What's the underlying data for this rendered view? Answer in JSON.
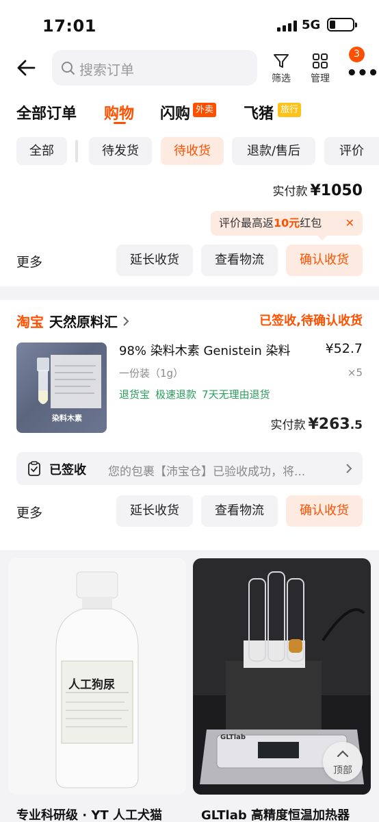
{
  "status_bar": {
    "time": "17:01",
    "network": "5G"
  },
  "header": {
    "search_placeholder": "搜索订单",
    "filter_label": "筛选",
    "manage_label": "管理",
    "more_badge": "3"
  },
  "category_tabs": [
    {
      "label": "全部订单",
      "active": false
    },
    {
      "label": "购物",
      "active": true
    },
    {
      "label": "闪购",
      "tag": "外卖",
      "tag_color": "#ff5000"
    },
    {
      "label": "飞猪",
      "tag": "旅行",
      "tag_color": "#ffc21a"
    }
  ],
  "filter_chips": [
    {
      "label": "全部",
      "active": false
    },
    {
      "label": "待发货",
      "active": false
    },
    {
      "label": "待收货",
      "active": true
    },
    {
      "label": "退款/售后",
      "active": false
    },
    {
      "label": "评价",
      "active": false
    }
  ],
  "order1": {
    "pay_label": "实付款",
    "pay_amount": "¥1050",
    "promo_prefix": "评价最高返",
    "promo_highlight": "10元",
    "promo_suffix": "红包",
    "more_label": "更多",
    "actions": [
      "延长收货",
      "查看物流",
      "确认收货"
    ]
  },
  "order2": {
    "platform": "淘宝",
    "shop_name": "天然原料汇",
    "status": "已签收,待确认收货",
    "product_name": "98% 染料木素 Genistein 染料",
    "product_price": "¥52.7",
    "product_spec": "一份装（1g）",
    "product_qty": "×5",
    "services": [
      "退货宝",
      "极速退款",
      "7天无理由退货"
    ],
    "pay_label": "实付款",
    "pay_amount": "¥263",
    "pay_decimal": ".5",
    "image_text": "染料木素",
    "logistics_status": "已签收",
    "logistics_desc": "您的包裹【沛宝仓】已验收成功，将...",
    "more_label": "更多",
    "actions": [
      "延长收货",
      "查看物流",
      "确认收货"
    ]
  },
  "recommendations": [
    {
      "title": "专业科研级 · YT 人工犬猫",
      "label_text": "人工狗尿"
    },
    {
      "title": "GLTlab 高精度恒温加热器",
      "brand_text": "GLTlab"
    }
  ],
  "top_button_label": "顶部",
  "colors": {
    "accent": "#ff5000",
    "accent_light": "#fdebe2",
    "service_green": "#2b9f5b",
    "background": "#f3f3f5"
  }
}
